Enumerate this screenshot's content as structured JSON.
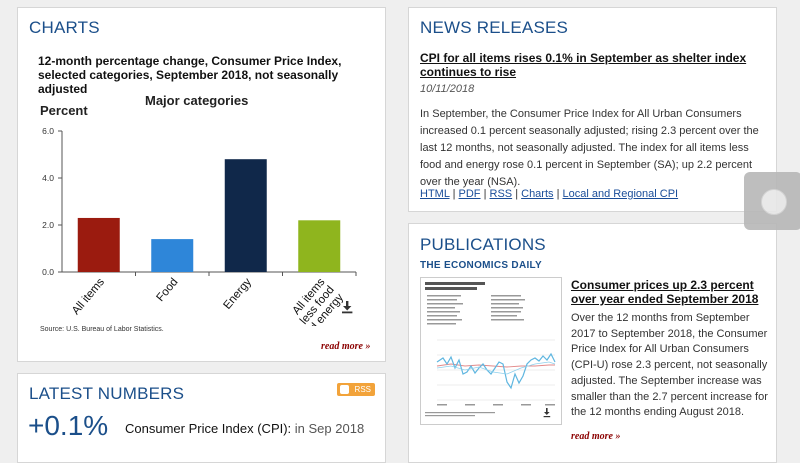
{
  "charts_panel": {
    "heading": "CHARTS",
    "title": "12-month percentage change, Consumer Price Index, selected categories, September 2018, not seasonally adjusted",
    "subtitle": "Major categories",
    "ylabel": "Percent",
    "source": "Source: U.S. Bureau of Labor Statistics.",
    "read_more": "read more »",
    "download_icon": "download-icon"
  },
  "chart_data": {
    "type": "bar",
    "title": "12-month percentage change, Consumer Price Index, selected categories, September 2018, not seasonally adjusted",
    "subtitle": "Major categories",
    "ylabel": "Percent",
    "categories": [
      "All items",
      "Food",
      "Energy",
      "All items less food and energy"
    ],
    "values": [
      2.3,
      1.4,
      4.8,
      2.2
    ],
    "colors": [
      "#9b1b0f",
      "#2e86d9",
      "#10284a",
      "#8fb51e"
    ],
    "ylim": [
      0,
      6
    ],
    "yticks": [
      "0.0",
      "2.0",
      "4.0",
      "6.0"
    ],
    "ytick_values": [
      0,
      2,
      4,
      6
    ],
    "grid": false
  },
  "news": {
    "heading": "NEWS RELEASES",
    "link": "CPI for all items rises 0.1% in September as shelter index continues to rise",
    "date": "10/11/2018",
    "body": "In September, the Consumer Price Index for All Urban Consumers increased 0.1 percent seasonally adjusted; rising 2.3 percent over the last 12 months, not seasonally adjusted. The index for all items less food and energy rose 0.1 percent in September (SA); up 2.2 percent over the year (NSA).",
    "links": [
      "HTML",
      "PDF",
      "RSS",
      "Charts",
      "Local and Regional CPI"
    ],
    "separator": " | "
  },
  "publications": {
    "heading": "PUBLICATIONS",
    "subheading": "THE ECONOMICS DAILY",
    "link": "Consumer prices up 2.3 percent over year ended September 2018",
    "body": "Over the 12 months from September 2017 to September 2018, the Consumer Price Index for All Urban Consumers (CPI-U) rose 2.3 percent, not seasonally adjusted. The September increase was smaller than the 2.7 percent increase for the 12 months ending August 2018.",
    "read_more": "read more »"
  },
  "latest": {
    "heading": "LATEST NUMBERS",
    "rss": "RSS",
    "value": "+0.1%",
    "label": "Consumer Price Index (CPI):",
    "period": " in Sep 2018"
  },
  "colors": {
    "heading": "#1b4f8a",
    "read_more": "#8b0000",
    "link": "#1a4d99",
    "rss": "#f2a33a"
  }
}
